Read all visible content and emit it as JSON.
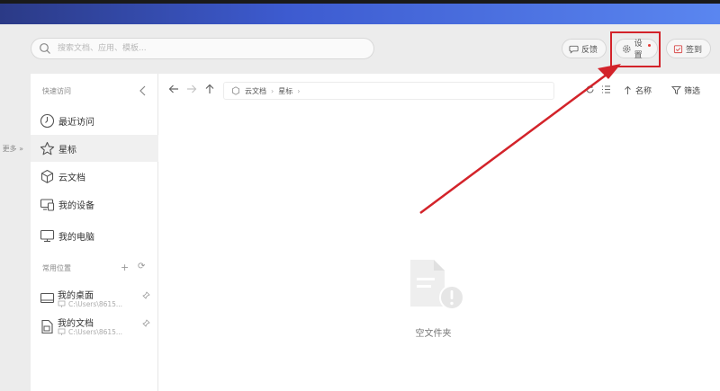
{
  "search": {
    "placeholder": "搜索文档、应用、模板..."
  },
  "header": {
    "feedback_label": "反馈",
    "settings_label": "设置",
    "checkin_label": "签到"
  },
  "sidebar": {
    "more_label": "更多 »",
    "quick_access_title": "快速访问",
    "items": [
      {
        "label": "最近访问",
        "icon": "clock-icon"
      },
      {
        "label": "星标",
        "icon": "star-icon"
      },
      {
        "label": "云文档",
        "icon": "cube-icon"
      },
      {
        "label": "我的设备",
        "icon": "devices-icon"
      },
      {
        "label": "我的电脑",
        "icon": "monitor-icon"
      }
    ],
    "common_title": "常用位置",
    "locations": [
      {
        "name": "我的桌面",
        "path": "C:\\Users\\8615..."
      },
      {
        "name": "我的文档",
        "path": "C:\\Users\\8615..."
      }
    ]
  },
  "toolbar": {
    "breadcrumb": [
      "云文档",
      "星标"
    ],
    "sort_label": "名称",
    "filter_label": "筛选"
  },
  "content": {
    "empty_label": "空文件夹"
  },
  "colors": {
    "highlight": "#d3232a",
    "accent_top": "#3d5bd0"
  }
}
